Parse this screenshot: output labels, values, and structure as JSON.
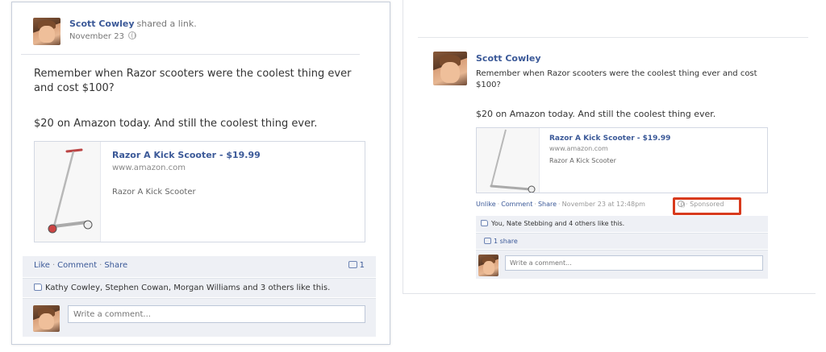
{
  "left_post": {
    "author": "Scott Cowley",
    "action": "shared a link.",
    "date": "November 23",
    "message_line1": "Remember when Razor scooters were the coolest thing ever and cost $100?",
    "message_line2": "$20 on Amazon today. And still the coolest thing ever.",
    "link": {
      "title": "Razor A Kick Scooter - $19.99",
      "url": "www.amazon.com",
      "description": "Razor A Kick Scooter"
    },
    "actions": {
      "like": "Like",
      "comment": "Comment",
      "share": "Share",
      "share_count": "1"
    },
    "likes_text": "Kathy Cowley, Stephen Cowan, Morgan Williams and 3 others like this.",
    "comment_placeholder": "Write a comment..."
  },
  "right_post": {
    "author": "Scott Cowley",
    "message_line1": "Remember when Razor scooters were the coolest thing ever and cost $100?",
    "message_line2": "$20 on Amazon today. And still the coolest thing ever.",
    "link": {
      "title": "Razor A Kick Scooter - $19.99",
      "url": "www.amazon.com",
      "description": "Razor A Kick Scooter"
    },
    "actions": {
      "unlike": "Unlike",
      "comment": "Comment",
      "share": "Share",
      "timestamp": "November 23 at 12:48pm",
      "sponsored": "Sponsored"
    },
    "likes_text": "You, Nate Stebbing and 4 others like this.",
    "shares_text": "1 share",
    "comment_placeholder": "Write a comment..."
  },
  "colors": {
    "link_blue": "#3b5998",
    "highlight_red": "#d83a1d",
    "panel_gray": "#eef0f5"
  }
}
